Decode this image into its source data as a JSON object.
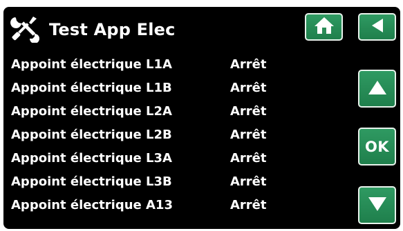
{
  "header": {
    "title": "Test App Elec",
    "icon": "tools-icon"
  },
  "nav": {
    "home_icon": "home-icon",
    "back_icon": "back-arrow-icon",
    "up_icon": "up-arrow-icon",
    "ok_label": "OK",
    "down_icon": "down-arrow-icon",
    "button_color": "#2a8c57"
  },
  "rows": [
    {
      "label": "Appoint électrique L1A",
      "value": "Arrêt"
    },
    {
      "label": "Appoint électrique L1B",
      "value": "Arrêt"
    },
    {
      "label": "Appoint électrique L2A",
      "value": "Arrêt"
    },
    {
      "label": "Appoint électrique L2B",
      "value": "Arrêt"
    },
    {
      "label": "Appoint électrique L3A",
      "value": "Arrêt"
    },
    {
      "label": "Appoint électrique L3B",
      "value": "Arrêt"
    },
    {
      "label": "Appoint électrique A13",
      "value": "Arrêt"
    }
  ]
}
